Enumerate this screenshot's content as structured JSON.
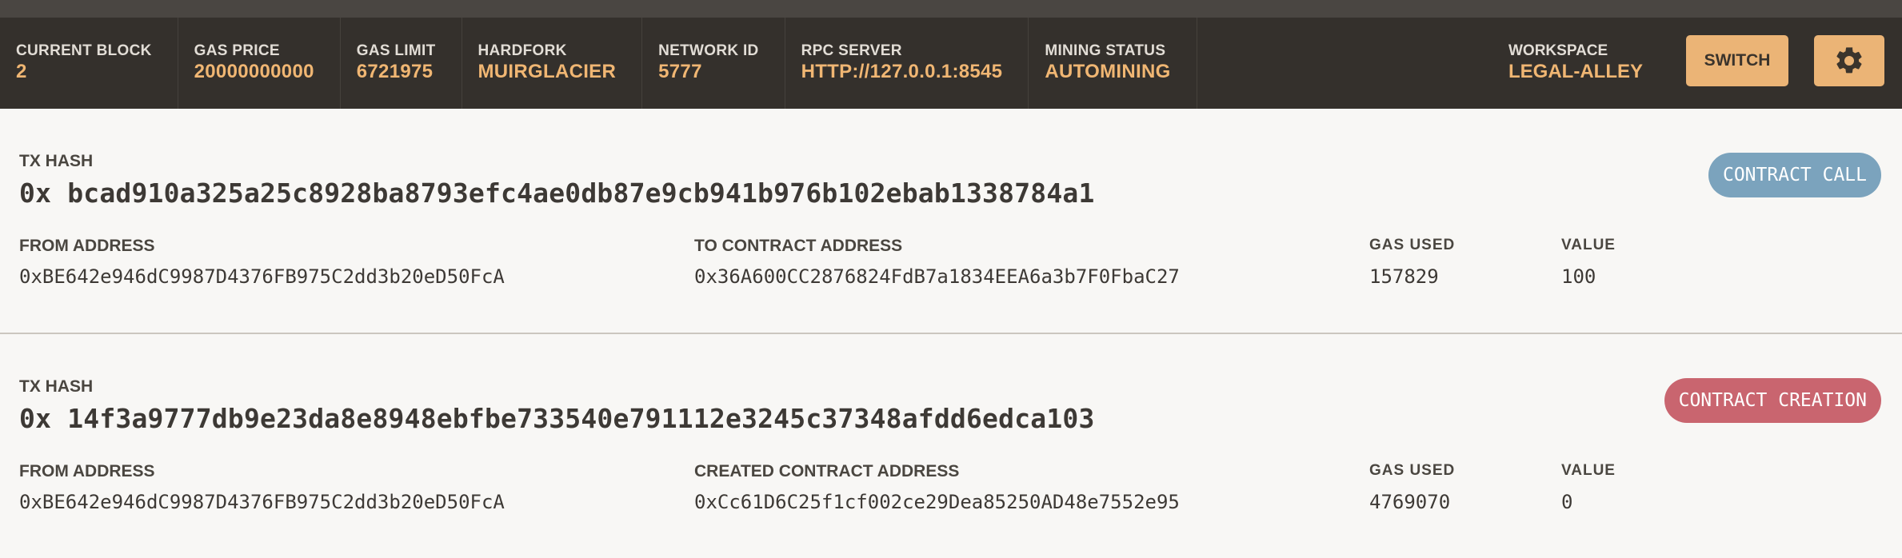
{
  "topbar": {
    "stats": [
      {
        "label": "CURRENT BLOCK",
        "value": "2"
      },
      {
        "label": "GAS PRICE",
        "value": "20000000000"
      },
      {
        "label": "GAS LIMIT",
        "value": "6721975"
      },
      {
        "label": "HARDFORK",
        "value": "MUIRGLACIER"
      },
      {
        "label": "NETWORK ID",
        "value": "5777"
      },
      {
        "label": "RPC SERVER",
        "value": "HTTP://127.0.0.1:8545"
      },
      {
        "label": "MINING STATUS",
        "value": "AUTOMINING"
      }
    ],
    "workspace": {
      "label": "WORKSPACE",
      "value": "LEGAL-ALLEY"
    },
    "switch_label": "SWITCH",
    "settings_icon": "gear-icon"
  },
  "colors": {
    "topbar_bg": "#34302c",
    "accent": "#f0b673",
    "button_bg": "#ebb476",
    "contract_call": "#7ba3bd",
    "contract_creation": "#c9656f"
  },
  "transactions": [
    {
      "hash_label": "TX HASH",
      "hash": "0x bcad910a325a25c8928ba8793efc4ae0db87e9cb941b976b102ebab1338784a1",
      "type": "CONTRACT CALL",
      "from_label": "FROM ADDRESS",
      "from": "0xBE642e946dC9987D4376FB975C2dd3b20eD50FcA",
      "to_label": "TO CONTRACT ADDRESS",
      "to": "0x36A600CC2876824FdB7a1834EEA6a3b7F0FbaC27",
      "gas_label": "GAS USED",
      "gas": "157829",
      "value_label": "VALUE",
      "value": "100"
    },
    {
      "hash_label": "TX HASH",
      "hash": "0x 14f3a9777db9e23da8e8948ebfbe733540e791112e3245c37348afdd6edca103",
      "type": "CONTRACT CREATION",
      "from_label": "FROM ADDRESS",
      "from": "0xBE642e946dC9987D4376FB975C2dd3b20eD50FcA",
      "to_label": "CREATED CONTRACT ADDRESS",
      "to": "0xCc61D6C25f1cf002ce29Dea85250AD48e7552e95",
      "gas_label": "GAS USED",
      "gas": "4769070",
      "value_label": "VALUE",
      "value": "0"
    }
  ]
}
